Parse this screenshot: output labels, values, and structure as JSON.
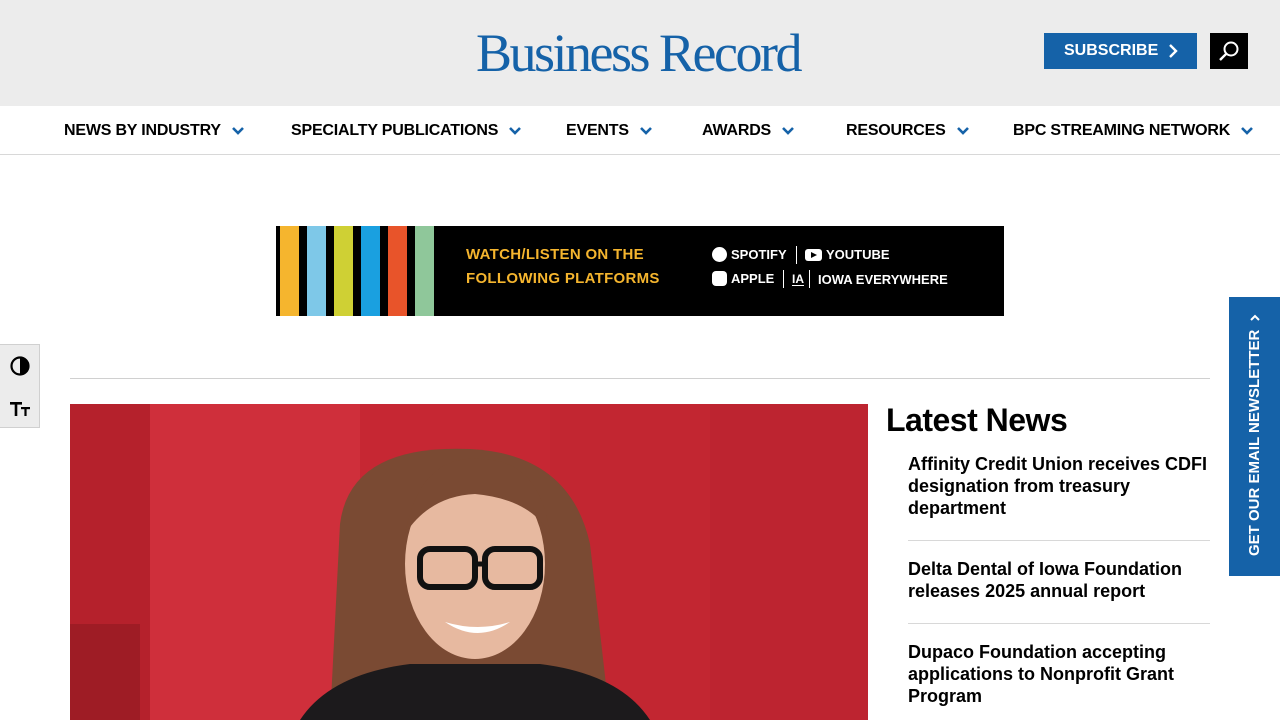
{
  "header": {
    "logo_text": "Business Record",
    "subscribe_label": "SUBSCRIBE",
    "brand_color": "#1562a8"
  },
  "nav": {
    "items": [
      {
        "label": "NEWS BY INDUSTRY"
      },
      {
        "label": "SPECIALTY PUBLICATIONS"
      },
      {
        "label": "EVENTS"
      },
      {
        "label": "AWARDS"
      },
      {
        "label": "RESOURCES"
      },
      {
        "label": "BPC STREAMING NETWORK"
      }
    ]
  },
  "banner": {
    "line1": "WATCH/LISTEN ON THE",
    "line2": "FOLLOWING PLATFORMS",
    "platforms": [
      "SPOTIFY",
      "YOUTUBE",
      "APPLE",
      "IOWA EVERYWHERE"
    ],
    "stripe_colors": [
      "#f5b52e",
      "#7ec8e8",
      "#cfd034",
      "#1aa0e0",
      "#e8542a",
      "#8fc79a"
    ]
  },
  "tools": {
    "contrast_icon": "contrast-icon",
    "font_size_icon": "font-size-icon"
  },
  "latest": {
    "title": "Latest News",
    "items": [
      {
        "headline": "Affinity Credit Union receives CDFI designation from treasury department"
      },
      {
        "headline": "Delta Dental of Iowa Foundation releases 2025 annual report"
      },
      {
        "headline": "Dupaco Foundation accepting applications to Nonprofit Grant Program"
      }
    ]
  },
  "newsletter": {
    "label": "GET OUR EMAIL NEWSLETTER"
  }
}
